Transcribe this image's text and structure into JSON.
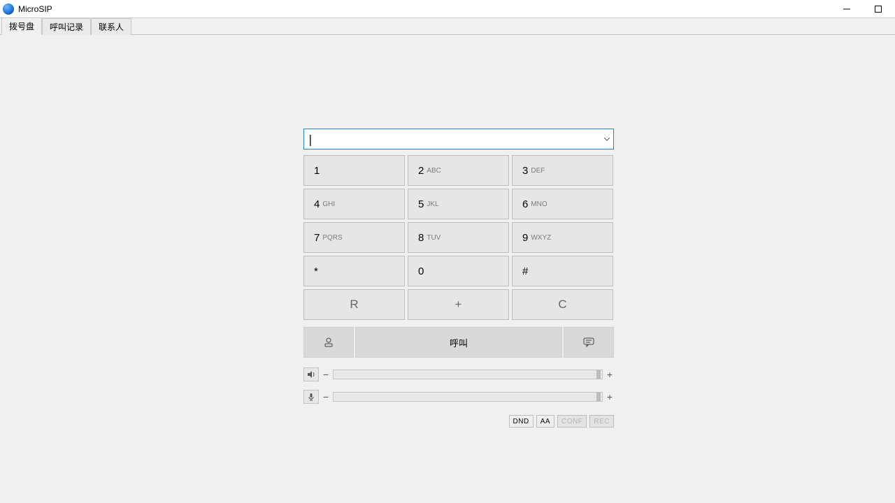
{
  "window": {
    "title": "MicroSIP"
  },
  "tabs": [
    {
      "label": "拨号盘",
      "active": true
    },
    {
      "label": "呼叫记录",
      "active": false
    },
    {
      "label": "联系人",
      "active": false
    }
  ],
  "dial_input": {
    "value": ""
  },
  "keypad": [
    {
      "digit": "1",
      "letters": ""
    },
    {
      "digit": "2",
      "letters": "ABC"
    },
    {
      "digit": "3",
      "letters": "DEF"
    },
    {
      "digit": "4",
      "letters": "GHI"
    },
    {
      "digit": "5",
      "letters": "JKL"
    },
    {
      "digit": "6",
      "letters": "MNO"
    },
    {
      "digit": "7",
      "letters": "PQRS"
    },
    {
      "digit": "8",
      "letters": "TUV"
    },
    {
      "digit": "9",
      "letters": "WXYZ"
    },
    {
      "digit": "*",
      "letters": ""
    },
    {
      "digit": "0",
      "letters": ""
    },
    {
      "digit": "#",
      "letters": ""
    }
  ],
  "func_keys": {
    "redial": "R",
    "plus": "+",
    "clear": "C"
  },
  "call": {
    "label": "呼叫"
  },
  "volume": {
    "speaker": {
      "level_pct": 98,
      "minus": "−",
      "plus": "+"
    },
    "mic": {
      "level_pct": 98,
      "minus": "−",
      "plus": "+"
    }
  },
  "toggles": {
    "dnd": {
      "label": "DND",
      "on": true
    },
    "aa": {
      "label": "AA",
      "on": true
    },
    "conf": {
      "label": "CONF",
      "on": false
    },
    "rec": {
      "label": "REC",
      "on": false
    }
  }
}
